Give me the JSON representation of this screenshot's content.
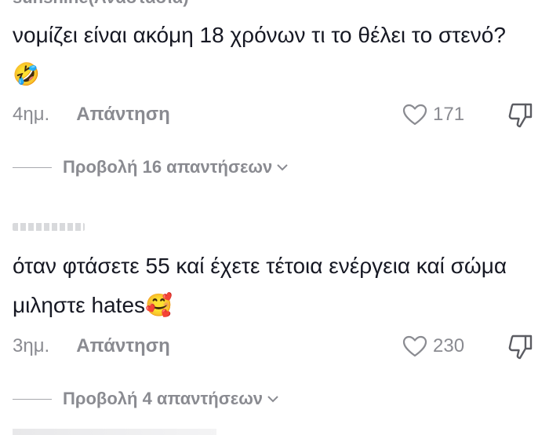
{
  "comments": [
    {
      "username": "sunshine(Αναστασία)",
      "text": "νομίζει είναι ακόμη 18 χρόνων τι το θέλει το στενό?",
      "emoji": "🤣",
      "time": "4ημ.",
      "reply_label": "Απάντηση",
      "likes": "171",
      "view_replies_label": "Προβολή 16 απαντήσεων"
    },
    {
      "text": "όταν φτάσετε 55 καί έχετε τέτοια ενέργεια καί σώμα μιληστε hates",
      "emoji": "🥰",
      "time": "3ημ.",
      "reply_label": "Απάντηση",
      "likes": "230",
      "view_replies_label": "Προβολή 4 απαντήσεων"
    }
  ],
  "icons": {
    "like": "heart-outline-icon",
    "dislike": "thumbs-down-icon",
    "expand": "chevron-down-icon"
  },
  "colors": {
    "text": "#161823",
    "muted": "#8a8b91"
  }
}
